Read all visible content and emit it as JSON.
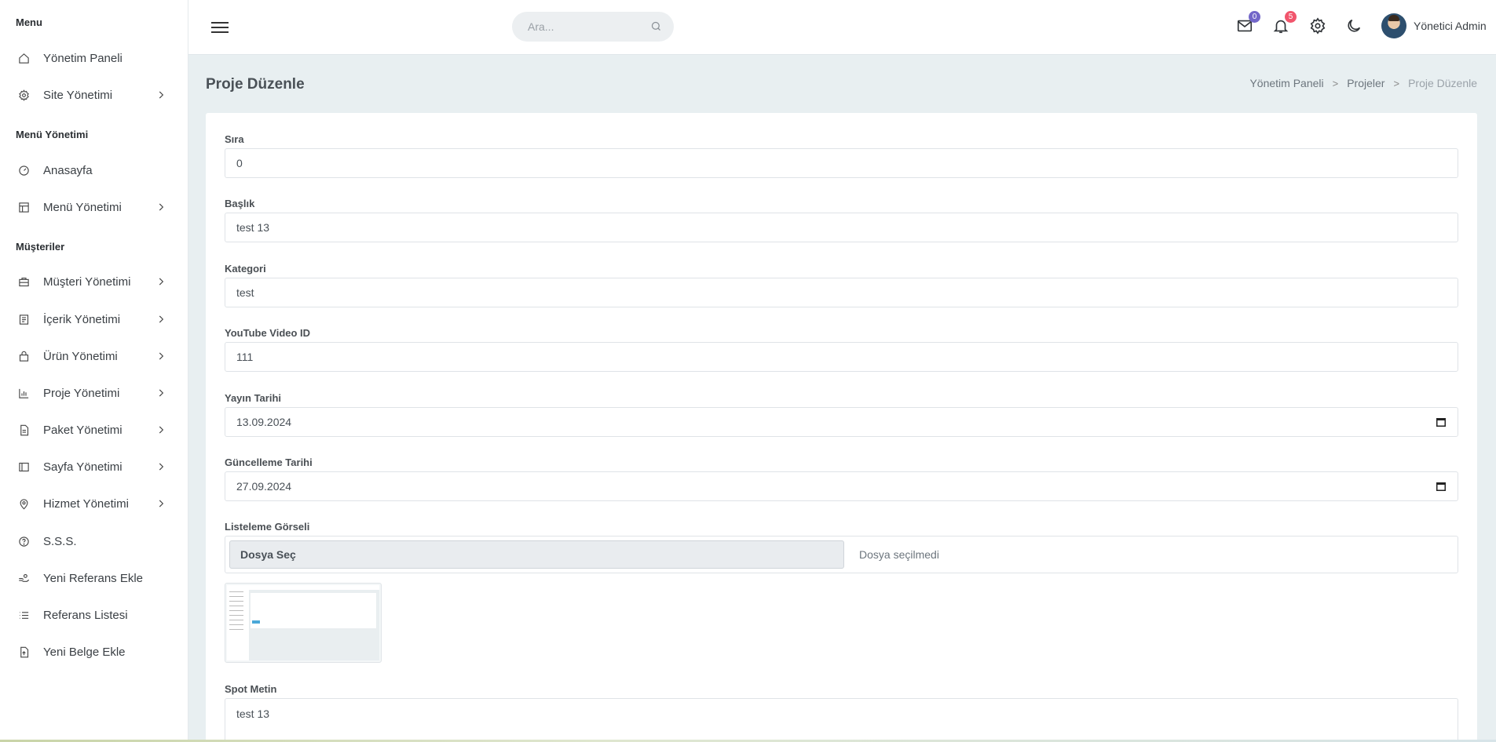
{
  "sidebar": {
    "sections": [
      {
        "heading": "Menu",
        "items": [
          {
            "label": "Yönetim Paneli",
            "icon": "home-icon",
            "chevron": false
          },
          {
            "label": "Site Yönetimi",
            "icon": "gear-icon",
            "chevron": true
          }
        ]
      },
      {
        "heading": "Menü Yönetimi",
        "items": [
          {
            "label": "Anasayfa",
            "icon": "dashboard-gauge-icon",
            "chevron": false
          },
          {
            "label": "Menü Yönetimi",
            "icon": "layout-icon",
            "chevron": true
          }
        ]
      },
      {
        "heading": "Müşteriler",
        "items": [
          {
            "label": "Müşteri Yönetimi",
            "icon": "briefcase-icon",
            "chevron": true
          },
          {
            "label": "İçerik Yönetimi",
            "icon": "content-list-icon",
            "chevron": true
          },
          {
            "label": "Ürün Yönetimi",
            "icon": "shopping-bag-icon",
            "chevron": true
          },
          {
            "label": "Proje Yönetimi",
            "icon": "bar-chart-icon",
            "chevron": true
          },
          {
            "label": "Paket Yönetimi",
            "icon": "document-icon",
            "chevron": true
          },
          {
            "label": "Sayfa Yönetimi",
            "icon": "page-layout-icon",
            "chevron": true
          },
          {
            "label": "Hizmet Yönetimi",
            "icon": "location-pin-icon",
            "chevron": true
          },
          {
            "label": "S.S.S.",
            "icon": "question-circle-icon",
            "chevron": false
          },
          {
            "label": "Yeni Referans Ekle",
            "icon": "hand-coin-icon",
            "chevron": false
          },
          {
            "label": "Referans Listesi",
            "icon": "list-icon",
            "chevron": false
          },
          {
            "label": "Yeni Belge Ekle",
            "icon": "file-upload-icon",
            "chevron": false
          }
        ]
      }
    ]
  },
  "topbar": {
    "search_placeholder": "Ara...",
    "mail_count": "0",
    "notification_count": "5",
    "user_name": "Yönetici Admin",
    "colors": {
      "mail_badge": "#7367c9",
      "notification_badge": "#f1556c"
    }
  },
  "page": {
    "title": "Proje Düzenle",
    "breadcrumb": [
      "Yönetim Paneli",
      "Projeler",
      "Proje Düzenle"
    ]
  },
  "form": {
    "sira": {
      "label": "Sıra",
      "value": "0"
    },
    "baslik": {
      "label": "Başlık",
      "value": "test 13"
    },
    "kategori": {
      "label": "Kategori",
      "value": "test"
    },
    "youtube": {
      "label": "YouTube Video ID",
      "value": "111"
    },
    "yayin": {
      "label": "Yayın Tarihi",
      "value": "13.09.2024"
    },
    "guncelleme": {
      "label": "Güncelleme Tarihi",
      "value": "27.09.2024"
    },
    "gorsel": {
      "label": "Listeleme Görseli",
      "button": "Dosya Seç",
      "status": "Dosya seçilmedi"
    },
    "spot": {
      "label": "Spot Metin",
      "value": "test 13"
    }
  }
}
